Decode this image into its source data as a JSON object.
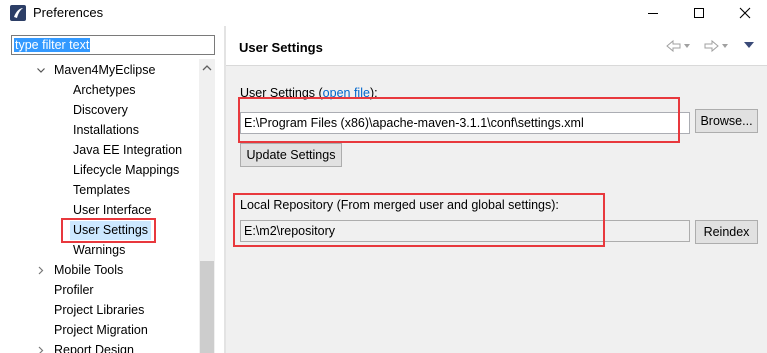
{
  "window": {
    "title": "Preferences",
    "app_icon": "eclipse-icon",
    "controls": [
      "minimize-icon",
      "maximize-icon",
      "close-icon"
    ]
  },
  "sidebar": {
    "filter_text": "type filter text",
    "items": [
      {
        "label": "Maven4MyEclipse",
        "expanded": true
      },
      {
        "label": "Archetypes"
      },
      {
        "label": "Discovery"
      },
      {
        "label": "Installations"
      },
      {
        "label": "Java EE Integration"
      },
      {
        "label": "Lifecycle Mappings"
      },
      {
        "label": "Templates"
      },
      {
        "label": "User Interface"
      },
      {
        "label": "User Settings",
        "selected": true
      },
      {
        "label": "Warnings"
      },
      {
        "label": "Mobile Tools",
        "expanded": false
      },
      {
        "label": "Profiler"
      },
      {
        "label": "Project Libraries"
      },
      {
        "label": "Project Migration"
      },
      {
        "label": "Report Design",
        "expanded": false
      }
    ]
  },
  "page": {
    "title": "User Settings",
    "nav_icons": [
      "back-arrow-icon",
      "forward-arrow-icon",
      "menu-dropdown-icon"
    ],
    "user_settings": {
      "label": "User Settings (",
      "link": "open file",
      "label_end": "):",
      "value": "E:\\Program Files (x86)\\apache-maven-3.1.1\\conf\\settings.xml",
      "browse_label": "Browse...",
      "update_label": "Update Settings"
    },
    "local_repo": {
      "label": "Local Repository (From merged user and global settings):",
      "value": "E:\\m2\\repository",
      "reindex_label": "Reindex"
    }
  },
  "colors": {
    "highlight_red": "#e8383d",
    "selection_blue": "#cce8ff",
    "link_blue": "#0066cc"
  }
}
